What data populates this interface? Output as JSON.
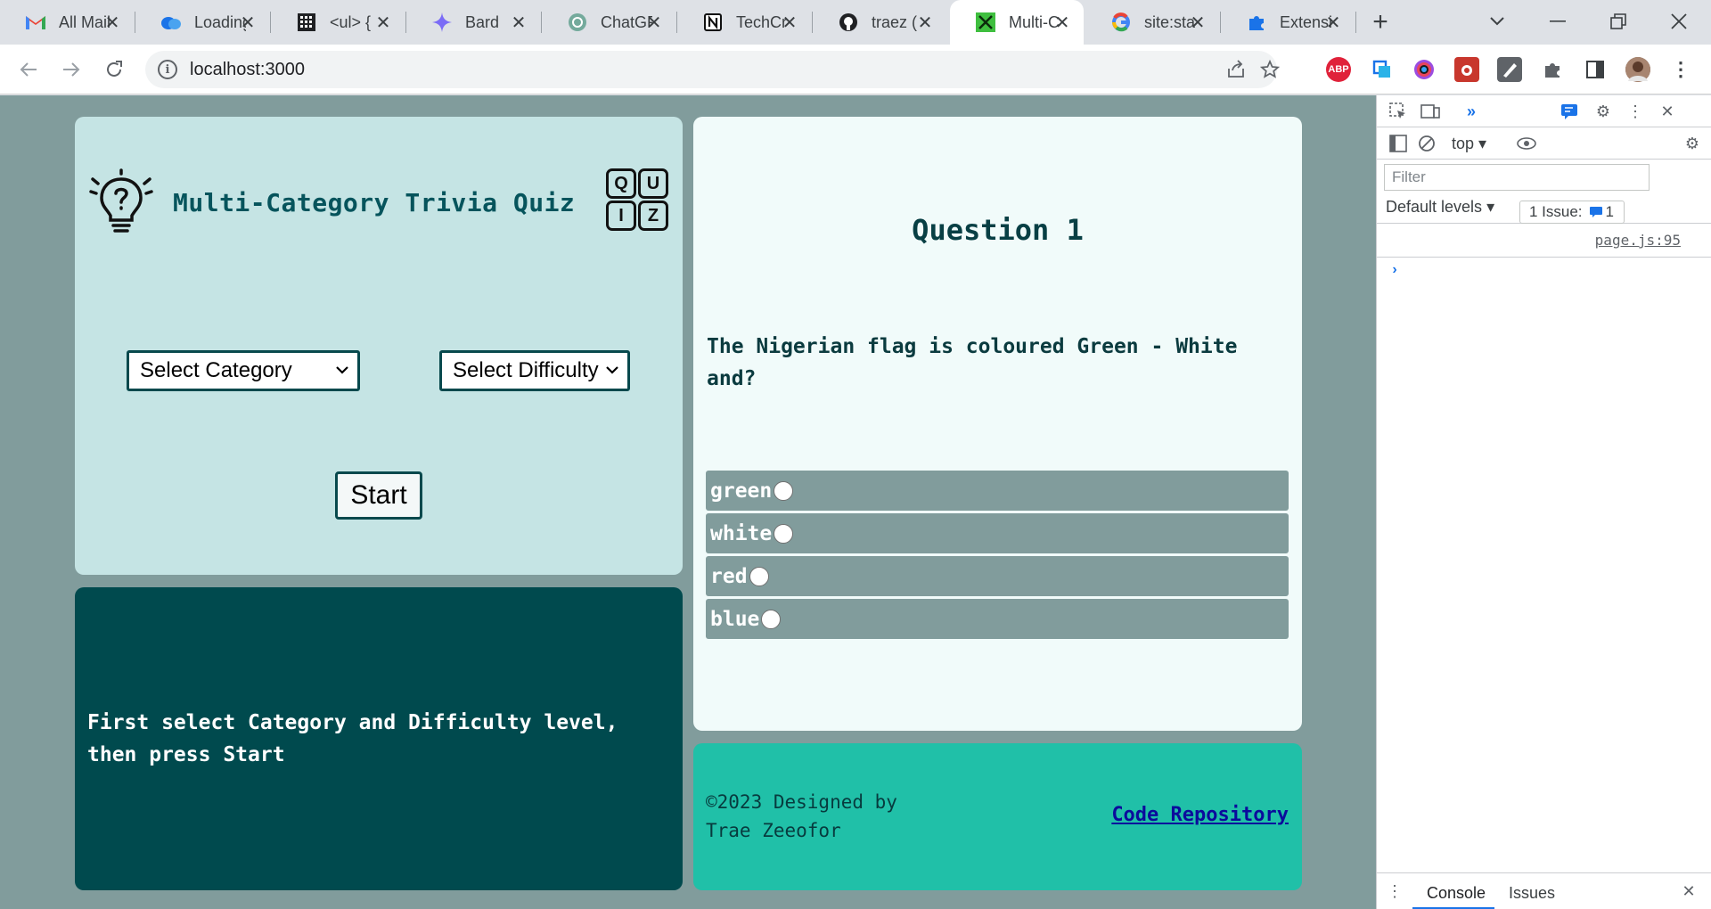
{
  "browser": {
    "tabs": [
      {
        "title": "All Mail",
        "icon": "gmail-icon"
      },
      {
        "title": "Loading",
        "icon": "cloud-icon"
      },
      {
        "title": "<ul> {",
        "icon": "grid-icon"
      },
      {
        "title": "Bard",
        "icon": "sparkle-icon"
      },
      {
        "title": "ChatGPT",
        "icon": "chatgpt-icon"
      },
      {
        "title": "TechCrunch",
        "icon": "notion-icon"
      },
      {
        "title": "traez (",
        "icon": "github-icon"
      },
      {
        "title": "Multi-Category",
        "icon": "quiz-favicon-icon",
        "active": true
      },
      {
        "title": "site:sta",
        "icon": "google-icon"
      },
      {
        "title": "Extensions",
        "icon": "puzzle-icon"
      }
    ],
    "url": "localhost:3000",
    "extension_badge": "ABP"
  },
  "quiz": {
    "title": "Multi-Category Trivia Quiz",
    "badge_letters": [
      "Q",
      "U",
      "I",
      "Z"
    ],
    "category_select": "Select Category",
    "difficulty_select": "Select Difficulty",
    "start_label": "Start",
    "question_title": "Question 1",
    "question_text": "The Nigerian flag is coloured Green - White and?",
    "options": [
      "green",
      "white",
      "red",
      "blue"
    ],
    "message": "First select Category and Difficulty level, then press Start",
    "footer_line1": "©2023 Designed by",
    "footer_line2": "Trae Zeeofor",
    "repo_link": "Code Repository"
  },
  "devtools": {
    "context": "top",
    "filter_placeholder": "Filter",
    "levels": "Default levels",
    "issue_label": "1 Issue:",
    "issue_count": "1",
    "source_link": "page.js:95",
    "bottom_tabs": [
      "Console",
      "Issues"
    ]
  },
  "colors": {
    "page_bg": "#819c9c",
    "header_card": "#c5e4e4",
    "question_card": "#f1fbfa",
    "message_card": "#004a4e",
    "footer_card": "#20c0a8"
  }
}
